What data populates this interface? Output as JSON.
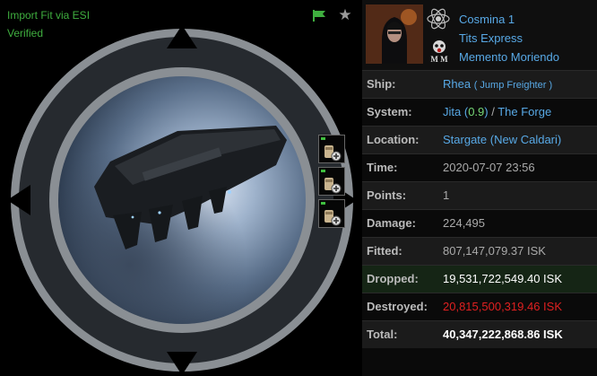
{
  "esi": {
    "link_label": "Import Fit via ESI",
    "verified_label": "Verified"
  },
  "icons": {
    "flag": "flag-icon",
    "star": "star-icon",
    "cargo": "cargo-container-icon"
  },
  "colors": {
    "link": "#58a9e6",
    "esi_green": "#3fae3f",
    "security_green": "#76d776",
    "destroyed_red": "#e02020",
    "dropped_bg": "#152515"
  },
  "victim": {
    "pilot": "Cosmina 1",
    "corporation": "Tits Express",
    "alliance": "Memento Moriendo",
    "alliance_logo_text": "M M"
  },
  "details": {
    "ship_label": "Ship:",
    "ship_name": "Rhea",
    "ship_class": "( Jump Freighter )",
    "system_label": "System:",
    "system_name": "Jita",
    "system_sec": "0.9",
    "system_sec_open": " (",
    "system_sec_close": ")",
    "system_sep": " / ",
    "region": "The Forge",
    "location_label": "Location:",
    "location": "Stargate (New Caldari)",
    "time_label": "Time:",
    "time": "2020-07-07 23:56",
    "points_label": "Points:",
    "points": "1",
    "damage_label": "Damage:",
    "damage": "224,495",
    "fitted_label": "Fitted:",
    "fitted": "807,147,079.37 ISK",
    "dropped_label": "Dropped:",
    "dropped": "19,531,722,549.40 ISK",
    "destroyed_label": "Destroyed:",
    "destroyed": "20,815,500,319.46 ISK",
    "total_label": "Total:",
    "total": "40,347,222,868.86 ISK"
  }
}
